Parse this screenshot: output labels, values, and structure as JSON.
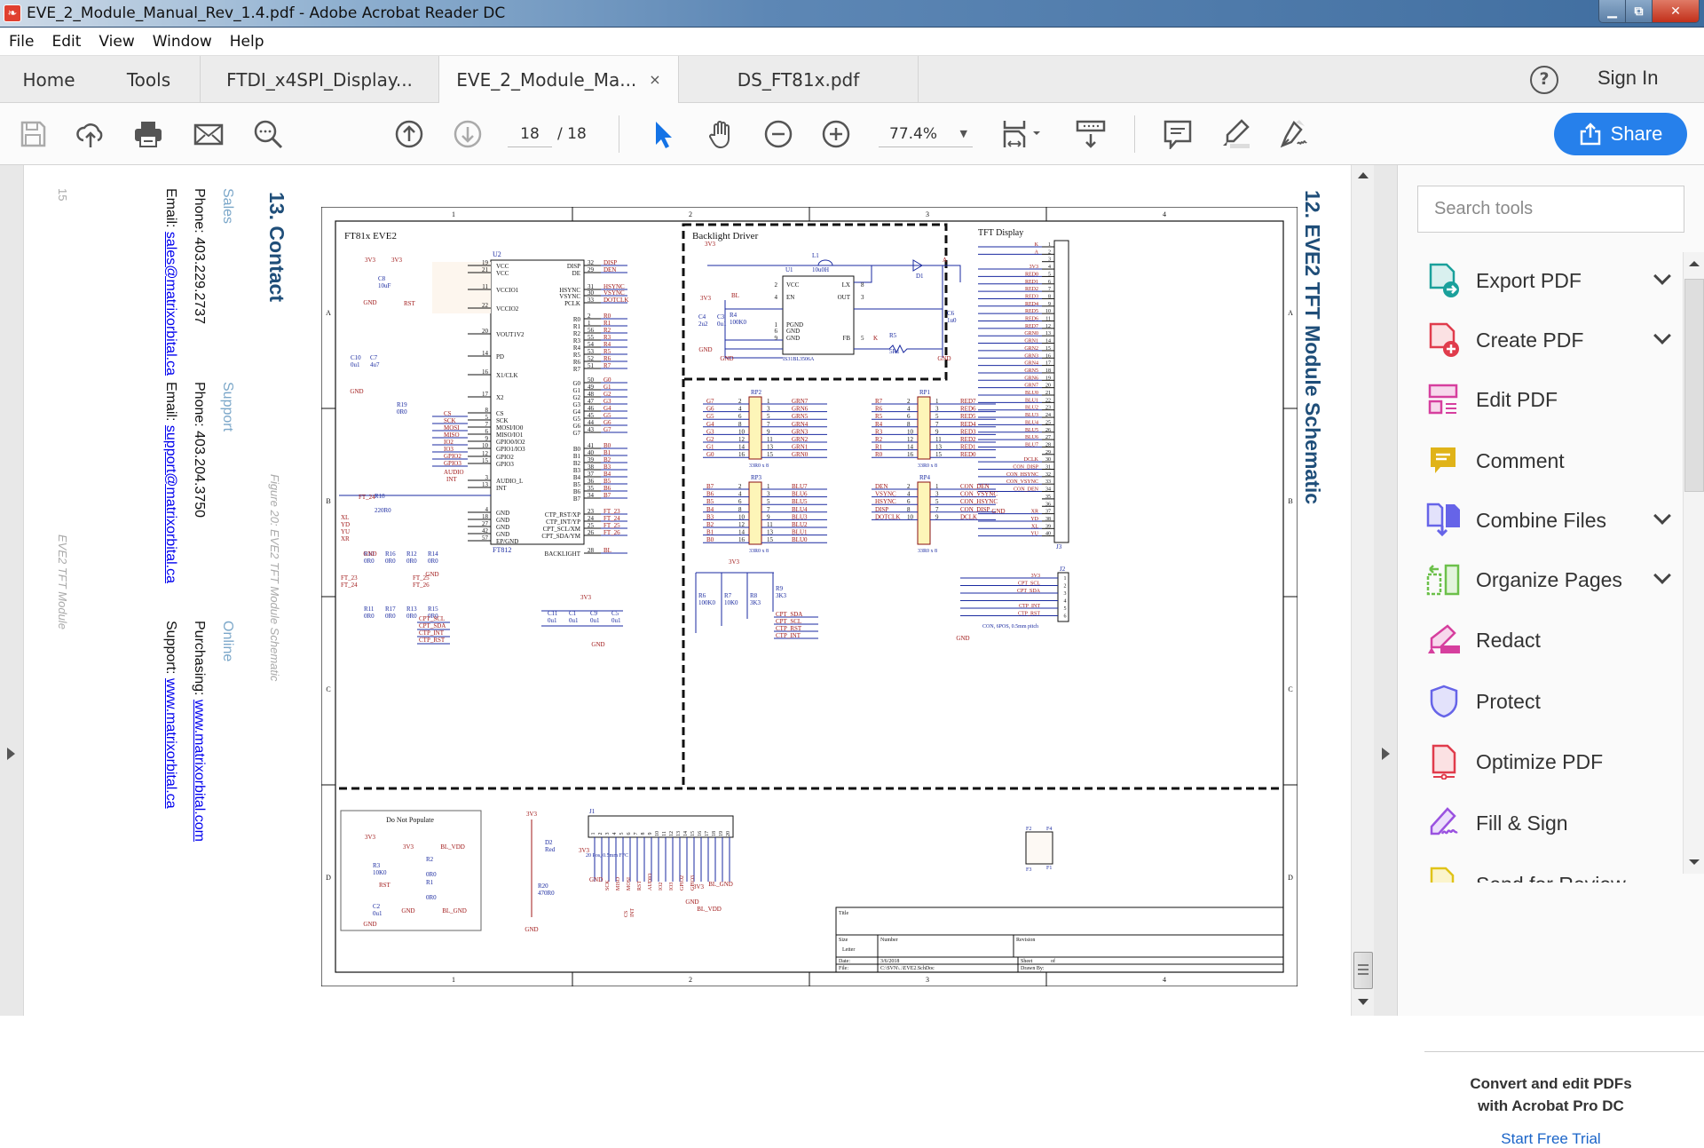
{
  "window": {
    "title": "EVE_2_Module_Manual_Rev_1.4.pdf - Adobe Acrobat Reader DC",
    "controls": [
      "minimize",
      "restore",
      "close"
    ]
  },
  "menu": [
    "File",
    "Edit",
    "View",
    "Window",
    "Help"
  ],
  "tabs": {
    "home": "Home",
    "tools": "Tools",
    "documents": [
      {
        "label": "FTDI_x4SPI_Display...",
        "active": false
      },
      {
        "label": "EVE_2_Module_Ma...",
        "active": true,
        "close": "×"
      },
      {
        "label": "DS_FT81x.pdf",
        "active": false
      }
    ],
    "sign_in": "Sign In",
    "help": "?"
  },
  "toolbar": {
    "page_current": "18",
    "page_total": "/ 18",
    "zoom": "77.4%",
    "share": "Share",
    "icons": [
      "save-icon",
      "upload-cloud-icon",
      "print-icon",
      "email-icon",
      "search-icon",
      "page-up-icon",
      "page-down-icon",
      "select-arrow-icon",
      "hand-icon",
      "zoom-out-icon",
      "zoom-in-icon",
      "fit-page-icon",
      "scroll-mode-icon",
      "comment-icon",
      "highlight-icon",
      "sign-icon"
    ]
  },
  "tools_pane": {
    "search_placeholder": "Search tools",
    "items": [
      {
        "label": "Export PDF",
        "expandable": true,
        "color": "#1aa09b"
      },
      {
        "label": "Create PDF",
        "expandable": true,
        "color": "#e03c4c"
      },
      {
        "label": "Edit PDF",
        "expandable": false,
        "color": "#d63f9e"
      },
      {
        "label": "Comment",
        "expandable": false,
        "color": "#e0b318"
      },
      {
        "label": "Combine Files",
        "expandable": true,
        "color": "#6664e8"
      },
      {
        "label": "Organize Pages",
        "expandable": true,
        "color": "#6cc04a"
      },
      {
        "label": "Redact",
        "expandable": false,
        "color": "#d63f9e"
      },
      {
        "label": "Protect",
        "expandable": false,
        "color": "#6664e8"
      },
      {
        "label": "Optimize PDF",
        "expandable": false,
        "color": "#e03c4c"
      },
      {
        "label": "Fill & Sign",
        "expandable": false,
        "color": "#9a52e0"
      },
      {
        "label": "Send for Review",
        "expandable": false,
        "color": "#e0c318"
      }
    ],
    "promo_line1": "Convert and edit PDFs",
    "promo_line2": "with Acrobat Pro DC",
    "trial_link": "Start Free Trial"
  },
  "document": {
    "contact_page": {
      "heading": "13. Contact",
      "sales_label": "Sales",
      "sales_phone": "Phone: 403.229.2737",
      "sales_email_prefix": "Email: ",
      "sales_email": "sales@matrixorbital.ca",
      "support_label": "Support",
      "support_phone": "Phone: 403.204.3750",
      "support_email_prefix": "Email: ",
      "support_email": "support@matrixorbital.ca",
      "online_label": "Online",
      "purchasing_prefix": "Purchasing: ",
      "purchasing_url": "www.matrixorbital.com",
      "support_url_prefix": "Support: ",
      "support_url": "www.matrixorbital.ca",
      "page_number": "15",
      "footer": "EVE2 TFT Module"
    },
    "figure_caption": "Figure 20: EVE2 TFT Module Schematic",
    "schematic_page": {
      "heading": "12. EVE2 TFT Module Schematic"
    },
    "schematic": {
      "col_labels": [
        "1",
        "2",
        "3",
        "4"
      ],
      "row_labels": [
        "A",
        "B",
        "C",
        "D"
      ],
      "sections": {
        "ft81x": "FT81x EVE2",
        "backlight": "Backlight Driver",
        "tft": "TFT Display",
        "dnp": "Do Not Populate"
      },
      "u2": {
        "ref": "U2",
        "part": "FT812",
        "left_pins": [
          {
            "num": "19",
            "name": "VCC"
          },
          {
            "num": "21",
            "name": "VCC"
          },
          {
            "num": "11",
            "name": "VCCIO1"
          },
          {
            "num": "22",
            "name": "VCCIO2"
          },
          {
            "num": "20",
            "name": "VOUT1V2"
          },
          {
            "num": "14",
            "name": "PD"
          },
          {
            "num": "16",
            "name": "X1/CLK"
          },
          {
            "num": "17",
            "name": "X2"
          },
          {
            "num": "8",
            "name": "CS"
          },
          {
            "num": "5",
            "name": "SCK"
          },
          {
            "num": "7",
            "name": "MOSI/IO0"
          },
          {
            "num": "6",
            "name": "MISO/IO1"
          },
          {
            "num": "9",
            "name": "GPIO0/IO2"
          },
          {
            "num": "10",
            "name": "GPIO1/IO3"
          },
          {
            "num": "12",
            "name": "GPIO2"
          },
          {
            "num": "15",
            "name": "GPIO3"
          },
          {
            "num": "3",
            "name": "AUDIO_L"
          },
          {
            "num": "13",
            "name": "INT"
          },
          {
            "num": "4",
            "name": "GND"
          },
          {
            "num": "18",
            "name": "GND"
          },
          {
            "num": "27",
            "name": "GND"
          },
          {
            "num": "42",
            "name": "GND"
          },
          {
            "num": "57",
            "name": "EP/GND"
          }
        ],
        "right_pins": [
          {
            "num": "32",
            "name": "DISP",
            "net": "DISP"
          },
          {
            "num": "29",
            "name": "DE",
            "net": "DEN"
          },
          {
            "num": "31",
            "name": "HSYNC",
            "net": "HSYNC"
          },
          {
            "num": "30",
            "name": "VSYNC",
            "net": "VSYNC"
          },
          {
            "num": "33",
            "name": "PCLK",
            "net": "DOTCLK"
          },
          {
            "num": "2",
            "name": "R0",
            "net": "R0"
          },
          {
            "num": "1",
            "name": "R1",
            "net": "R1"
          },
          {
            "num": "56",
            "name": "R2",
            "net": "R2"
          },
          {
            "num": "55",
            "name": "R3",
            "net": "R3"
          },
          {
            "num": "54",
            "name": "R4",
            "net": "R4"
          },
          {
            "num": "53",
            "name": "R5",
            "net": "R5"
          },
          {
            "num": "52",
            "name": "R6",
            "net": "R6"
          },
          {
            "num": "51",
            "name": "R7",
            "net": "R7"
          },
          {
            "num": "50",
            "name": "G0",
            "net": "G0"
          },
          {
            "num": "49",
            "name": "G1",
            "net": "G1"
          },
          {
            "num": "48",
            "name": "G2",
            "net": "G2"
          },
          {
            "num": "47",
            "name": "G3",
            "net": "G3"
          },
          {
            "num": "46",
            "name": "G4",
            "net": "G4"
          },
          {
            "num": "45",
            "name": "G5",
            "net": "G5"
          },
          {
            "num": "44",
            "name": "G6",
            "net": "G6"
          },
          {
            "num": "43",
            "name": "G7",
            "net": "G7"
          },
          {
            "num": "41",
            "name": "B0",
            "net": "B0"
          },
          {
            "num": "40",
            "name": "B1",
            "net": "B1"
          },
          {
            "num": "39",
            "name": "B2",
            "net": "B2"
          },
          {
            "num": "38",
            "name": "B3",
            "net": "B3"
          },
          {
            "num": "37",
            "name": "B4",
            "net": "B4"
          },
          {
            "num": "36",
            "name": "B5",
            "net": "B5"
          },
          {
            "num": "35",
            "name": "B6",
            "net": "B6"
          },
          {
            "num": "34",
            "name": "B7",
            "net": "B7"
          },
          {
            "num": "23",
            "name": "CTP_RST/XP",
            "net": "FT_23"
          },
          {
            "num": "24",
            "name": "CTP_INT/YP",
            "net": "FT_24"
          },
          {
            "num": "25",
            "name": "CPT_SCL/XM",
            "net": "FT_25"
          },
          {
            "num": "26",
            "name": "CPT_SDA/YM",
            "net": "FT_26"
          },
          {
            "num": "28",
            "name": "BACKLIGHT",
            "net": "BL"
          }
        ]
      },
      "caps_top": [
        {
          "ref": "C8",
          "val": "10uF"
        },
        {
          "ref": "C10",
          "val": "0u1"
        },
        {
          "ref": "C7",
          "val": "4u7"
        }
      ],
      "r19": {
        "ref": "R19",
        "val": "0R0"
      },
      "r18": {
        "ref": "R18",
        "val": "220R0",
        "net": "FT_24"
      },
      "touch_res": [
        {
          "ref": "R10",
          "val": "0R0"
        },
        {
          "ref": "R16",
          "val": "0R0"
        },
        {
          "ref": "R12",
          "val": "0R0"
        },
        {
          "ref": "R14",
          "val": "0R0"
        },
        {
          "ref": "R11",
          "val": "0R0"
        },
        {
          "ref": "R17",
          "val": "0R0"
        },
        {
          "ref": "R13",
          "val": "0R0"
        },
        {
          "ref": "R15",
          "val": "0R0"
        }
      ],
      "touch_nets_in": [
        "XL",
        "YD",
        "YU",
        "XR"
      ],
      "touch_nets_out": [
        "CPT_SCL",
        "CPT_SDA",
        "CTP_INT",
        "CTP_RST"
      ],
      "decoupling": [
        {
          "ref": "C11",
          "val": "0u1"
        },
        {
          "ref": "C1",
          "val": "0u1"
        },
        {
          "ref": "C9",
          "val": "0u1"
        },
        {
          "ref": "C5",
          "val": "0u1"
        }
      ],
      "backlight_driver": {
        "ic": "U1",
        "part": "IS31BL3506A",
        "pins": [
          {
            "num": "2",
            "name": "VCC"
          },
          {
            "num": "4",
            "name": "EN"
          },
          {
            "num": "1",
            "name": "PGND"
          },
          {
            "num": "6",
            "name": "GND"
          },
          {
            "num": "9",
            "name": "GND"
          },
          {
            "num": "8",
            "name": "LX"
          },
          {
            "num": "3",
            "name": "OUT"
          },
          {
            "num": "5",
            "name": "FB"
          }
        ],
        "l1": {
          "ref": "L1",
          "val": "10u0H"
        },
        "d1": "D1",
        "r4": {
          "ref": "R4",
          "val": "100K0"
        },
        "r5": {
          "ref": "R5",
          "val": "5R1"
        },
        "c6": {
          "ref": "C6",
          "val": "1u0"
        },
        "c4": {
          "ref": "C4",
          "val": "2u2"
        },
        "c3": {
          "ref": "C3",
          "val": "0u1"
        }
      },
      "resistor_packs": [
        {
          "ref": "RP2",
          "val": "33R0 x 8",
          "left": [
            "G7",
            "G6",
            "G5",
            "G4",
            "G3",
            "G2",
            "G1",
            "G0"
          ],
          "right": [
            "GRN7",
            "GRN6",
            "GRN5",
            "GRN4",
            "GRN3",
            "GRN2",
            "GRN1",
            "GRN0"
          ]
        },
        {
          "ref": "RP1",
          "val": "33R0 x 8",
          "left": [
            "R7",
            "R6",
            "R5",
            "R4",
            "R3",
            "R2",
            "R1",
            "R0"
          ],
          "right": [
            "RED7",
            "RED6",
            "RED5",
            "RED4",
            "RED3",
            "RED2",
            "RED1",
            "RED0"
          ]
        },
        {
          "ref": "RP3",
          "val": "33R0 x 8",
          "left": [
            "B7",
            "B6",
            "B5",
            "B4",
            "B3",
            "B2",
            "B1",
            "B0"
          ],
          "right": [
            "BLU7",
            "BLU6",
            "BLU5",
            "BLU4",
            "BLU3",
            "BLU2",
            "BLU1",
            "BLU0"
          ]
        },
        {
          "ref": "RP4",
          "val": "33R0 x 8",
          "left": [
            "DEN",
            "VSYNC",
            "HSYNC",
            "DISP",
            "DOTCLK"
          ],
          "right": [
            "CON_DEN",
            "CON_VSYNC",
            "CON_HSYNC",
            "CON_DISP",
            "DCLK"
          ]
        }
      ],
      "pullups": [
        {
          "ref": "R6",
          "val": "100K0"
        },
        {
          "ref": "R7",
          "val": "10K0"
        },
        {
          "ref": "R8",
          "val": "3K3"
        },
        {
          "ref": "R9",
          "val": "3K3"
        }
      ],
      "pullup_nets": [
        "CPT_SDA",
        "CPT_SCL",
        "CTP_RST",
        "CTP_INT"
      ],
      "j3": {
        "ref": "J3",
        "pins": [
          "K",
          "A",
          "",
          "3V3",
          "RED0",
          "RED1",
          "RED2",
          "RED3",
          "RED4",
          "RED5",
          "RED6",
          "RED7",
          "GRN0",
          "GRN1",
          "GRN2",
          "GRN3",
          "GRN4",
          "GRN5",
          "GRN6",
          "GRN7",
          "BLU0",
          "BLU1",
          "BLU2",
          "BLU3",
          "BLU4",
          "BLU5",
          "BLU6",
          "BLU7",
          "",
          "DCLK",
          "CON_DISP",
          "CON_HSYNC",
          "CON_VSYNC",
          "CON_DEN",
          "",
          "",
          "XR",
          "YD",
          "XL",
          "YU"
        ]
      },
      "j2": {
        "ref": "J2",
        "desc": "CON, 6POS, 0.5mm pitch",
        "pins": [
          "3V3",
          "CPT_SCL",
          "CPT_SDA",
          "GND",
          "CTP_INT",
          "CTP_RST"
        ]
      },
      "dnp": {
        "r3": {
          "ref": "R3",
          "val": "10K0"
        },
        "c2": {
          "ref": "C2",
          "val": "0u1"
        },
        "r2": {
          "ref": "R2",
          "val": "0R0"
        },
        "r1": {
          "ref": "R1",
          "val": "0R0"
        },
        "nets": [
          "3V3",
          "RST",
          "GND",
          "BL_VDD",
          "BL_GND"
        ]
      },
      "led": {
        "ref": "D2",
        "color": "Red",
        "r": {
          "ref": "R20",
          "val": "470R0"
        }
      },
      "j1": {
        "ref": "J1",
        "desc": "20 Pos, 0.5mm FFC",
        "pins": [
          "1",
          "2",
          "3",
          "4",
          "5",
          "6",
          "7",
          "8",
          "9",
          "10",
          "11",
          "12",
          "13",
          "14",
          "15",
          "16",
          "17",
          "18",
          "19",
          "20"
        ],
        "nets": [
          "3V3",
          "GND",
          "SCK",
          "MISO",
          "MOSI",
          "CS",
          "INT",
          "RST",
          "AUDIO",
          "IO2",
          "IO3",
          "GPIO2",
          "GPIO3",
          "GND",
          "3V3",
          "BL_VDD",
          "BL_GND"
        ]
      },
      "fiducials": [
        "F2",
        "F4",
        "F3",
        "F1"
      ],
      "title_block": {
        "title_label": "Title",
        "size_label": "Size",
        "size_value": "Letter",
        "number_label": "Number",
        "revision_label": "Revision",
        "date_label": "Date:",
        "date_value": "3/6/2018",
        "sheet_label": "Sheet",
        "of_label": "of",
        "file_label": "File:",
        "file_value": "C:\\SVN\\..\\EVE2.SchDoc",
        "drawn_label": "Drawn By:"
      }
    }
  }
}
